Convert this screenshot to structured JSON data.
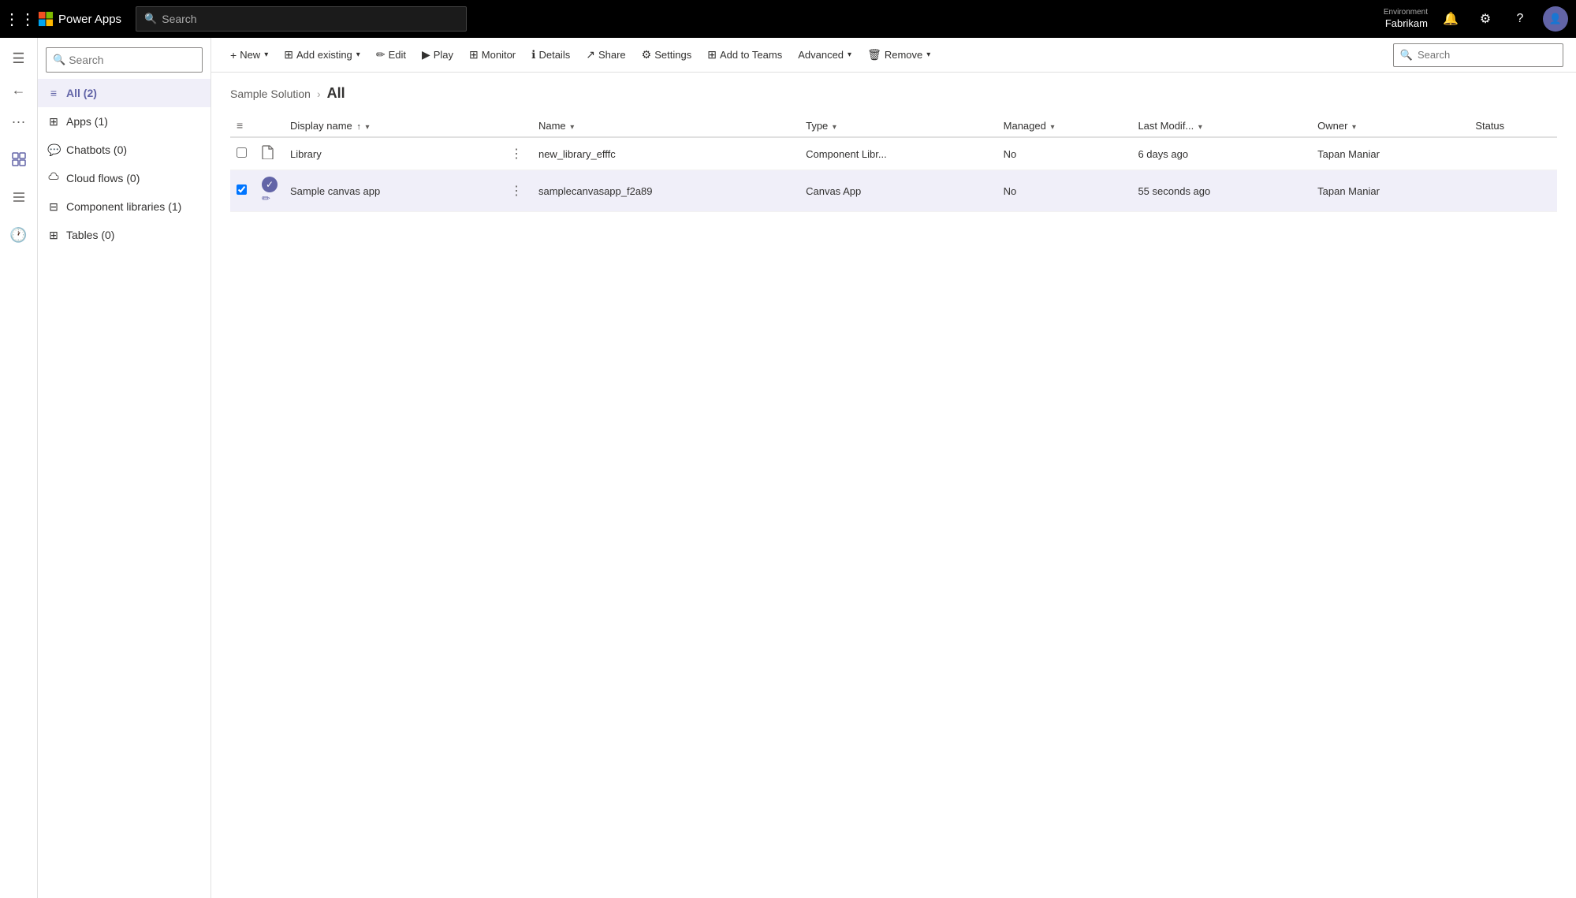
{
  "topNav": {
    "appName": "Power Apps",
    "searchPlaceholder": "Search",
    "env": {
      "label": "Environment",
      "name": "Fabrikam"
    }
  },
  "sidebar": {
    "searchPlaceholder": "Search",
    "items": [
      {
        "id": "all",
        "label": "All (2)",
        "icon": "≡",
        "active": true
      },
      {
        "id": "apps",
        "label": "Apps (1)",
        "icon": "⊞",
        "active": false
      },
      {
        "id": "chatbots",
        "label": "Chatbots (0)",
        "icon": "💬",
        "active": false
      },
      {
        "id": "cloud-flows",
        "label": "Cloud flows (0)",
        "icon": "∿",
        "active": false
      },
      {
        "id": "component-libraries",
        "label": "Component libraries (1)",
        "icon": "⊟",
        "active": false
      },
      {
        "id": "tables",
        "label": "Tables (0)",
        "icon": "⊞",
        "active": false
      }
    ]
  },
  "toolbar": {
    "new_label": "New",
    "add_existing_label": "Add existing",
    "edit_label": "Edit",
    "play_label": "Play",
    "monitor_label": "Monitor",
    "details_label": "Details",
    "share_label": "Share",
    "settings_label": "Settings",
    "add_to_teams_label": "Add to Teams",
    "advanced_label": "Advanced",
    "remove_label": "Remove",
    "search_placeholder": "Search"
  },
  "breadcrumb": {
    "parent": "Sample Solution",
    "current": "All"
  },
  "table": {
    "columns": [
      {
        "id": "display_name",
        "label": "Display name",
        "sortDir": "asc",
        "hasSort": true,
        "hasCaret": true
      },
      {
        "id": "name",
        "label": "Name",
        "sortDir": "",
        "hasSort": false,
        "hasCaret": true
      },
      {
        "id": "type",
        "label": "Type",
        "sortDir": "",
        "hasSort": false,
        "hasCaret": true
      },
      {
        "id": "managed",
        "label": "Managed",
        "sortDir": "",
        "hasSort": false,
        "hasCaret": true
      },
      {
        "id": "last_modified",
        "label": "Last Modif...",
        "sortDir": "",
        "hasSort": false,
        "hasCaret": true
      },
      {
        "id": "owner",
        "label": "Owner",
        "sortDir": "",
        "hasSort": false,
        "hasCaret": true
      },
      {
        "id": "status",
        "label": "Status",
        "sortDir": "",
        "hasSort": false,
        "hasCaret": false
      }
    ],
    "rows": [
      {
        "id": "library",
        "display_name": "Library",
        "name": "new_library_efffc",
        "type": "Component Libr...",
        "managed": "No",
        "last_modified": "6 days ago",
        "owner": "Tapan Maniar",
        "status": "",
        "selected": false,
        "icon": "doc"
      },
      {
        "id": "sample-canvas-app",
        "display_name": "Sample canvas app",
        "name": "samplecanvasapp_f2a89",
        "type": "Canvas App",
        "managed": "No",
        "last_modified": "55 seconds ago",
        "owner": "Tapan Maniar",
        "status": "",
        "selected": true,
        "icon": "check"
      }
    ]
  }
}
